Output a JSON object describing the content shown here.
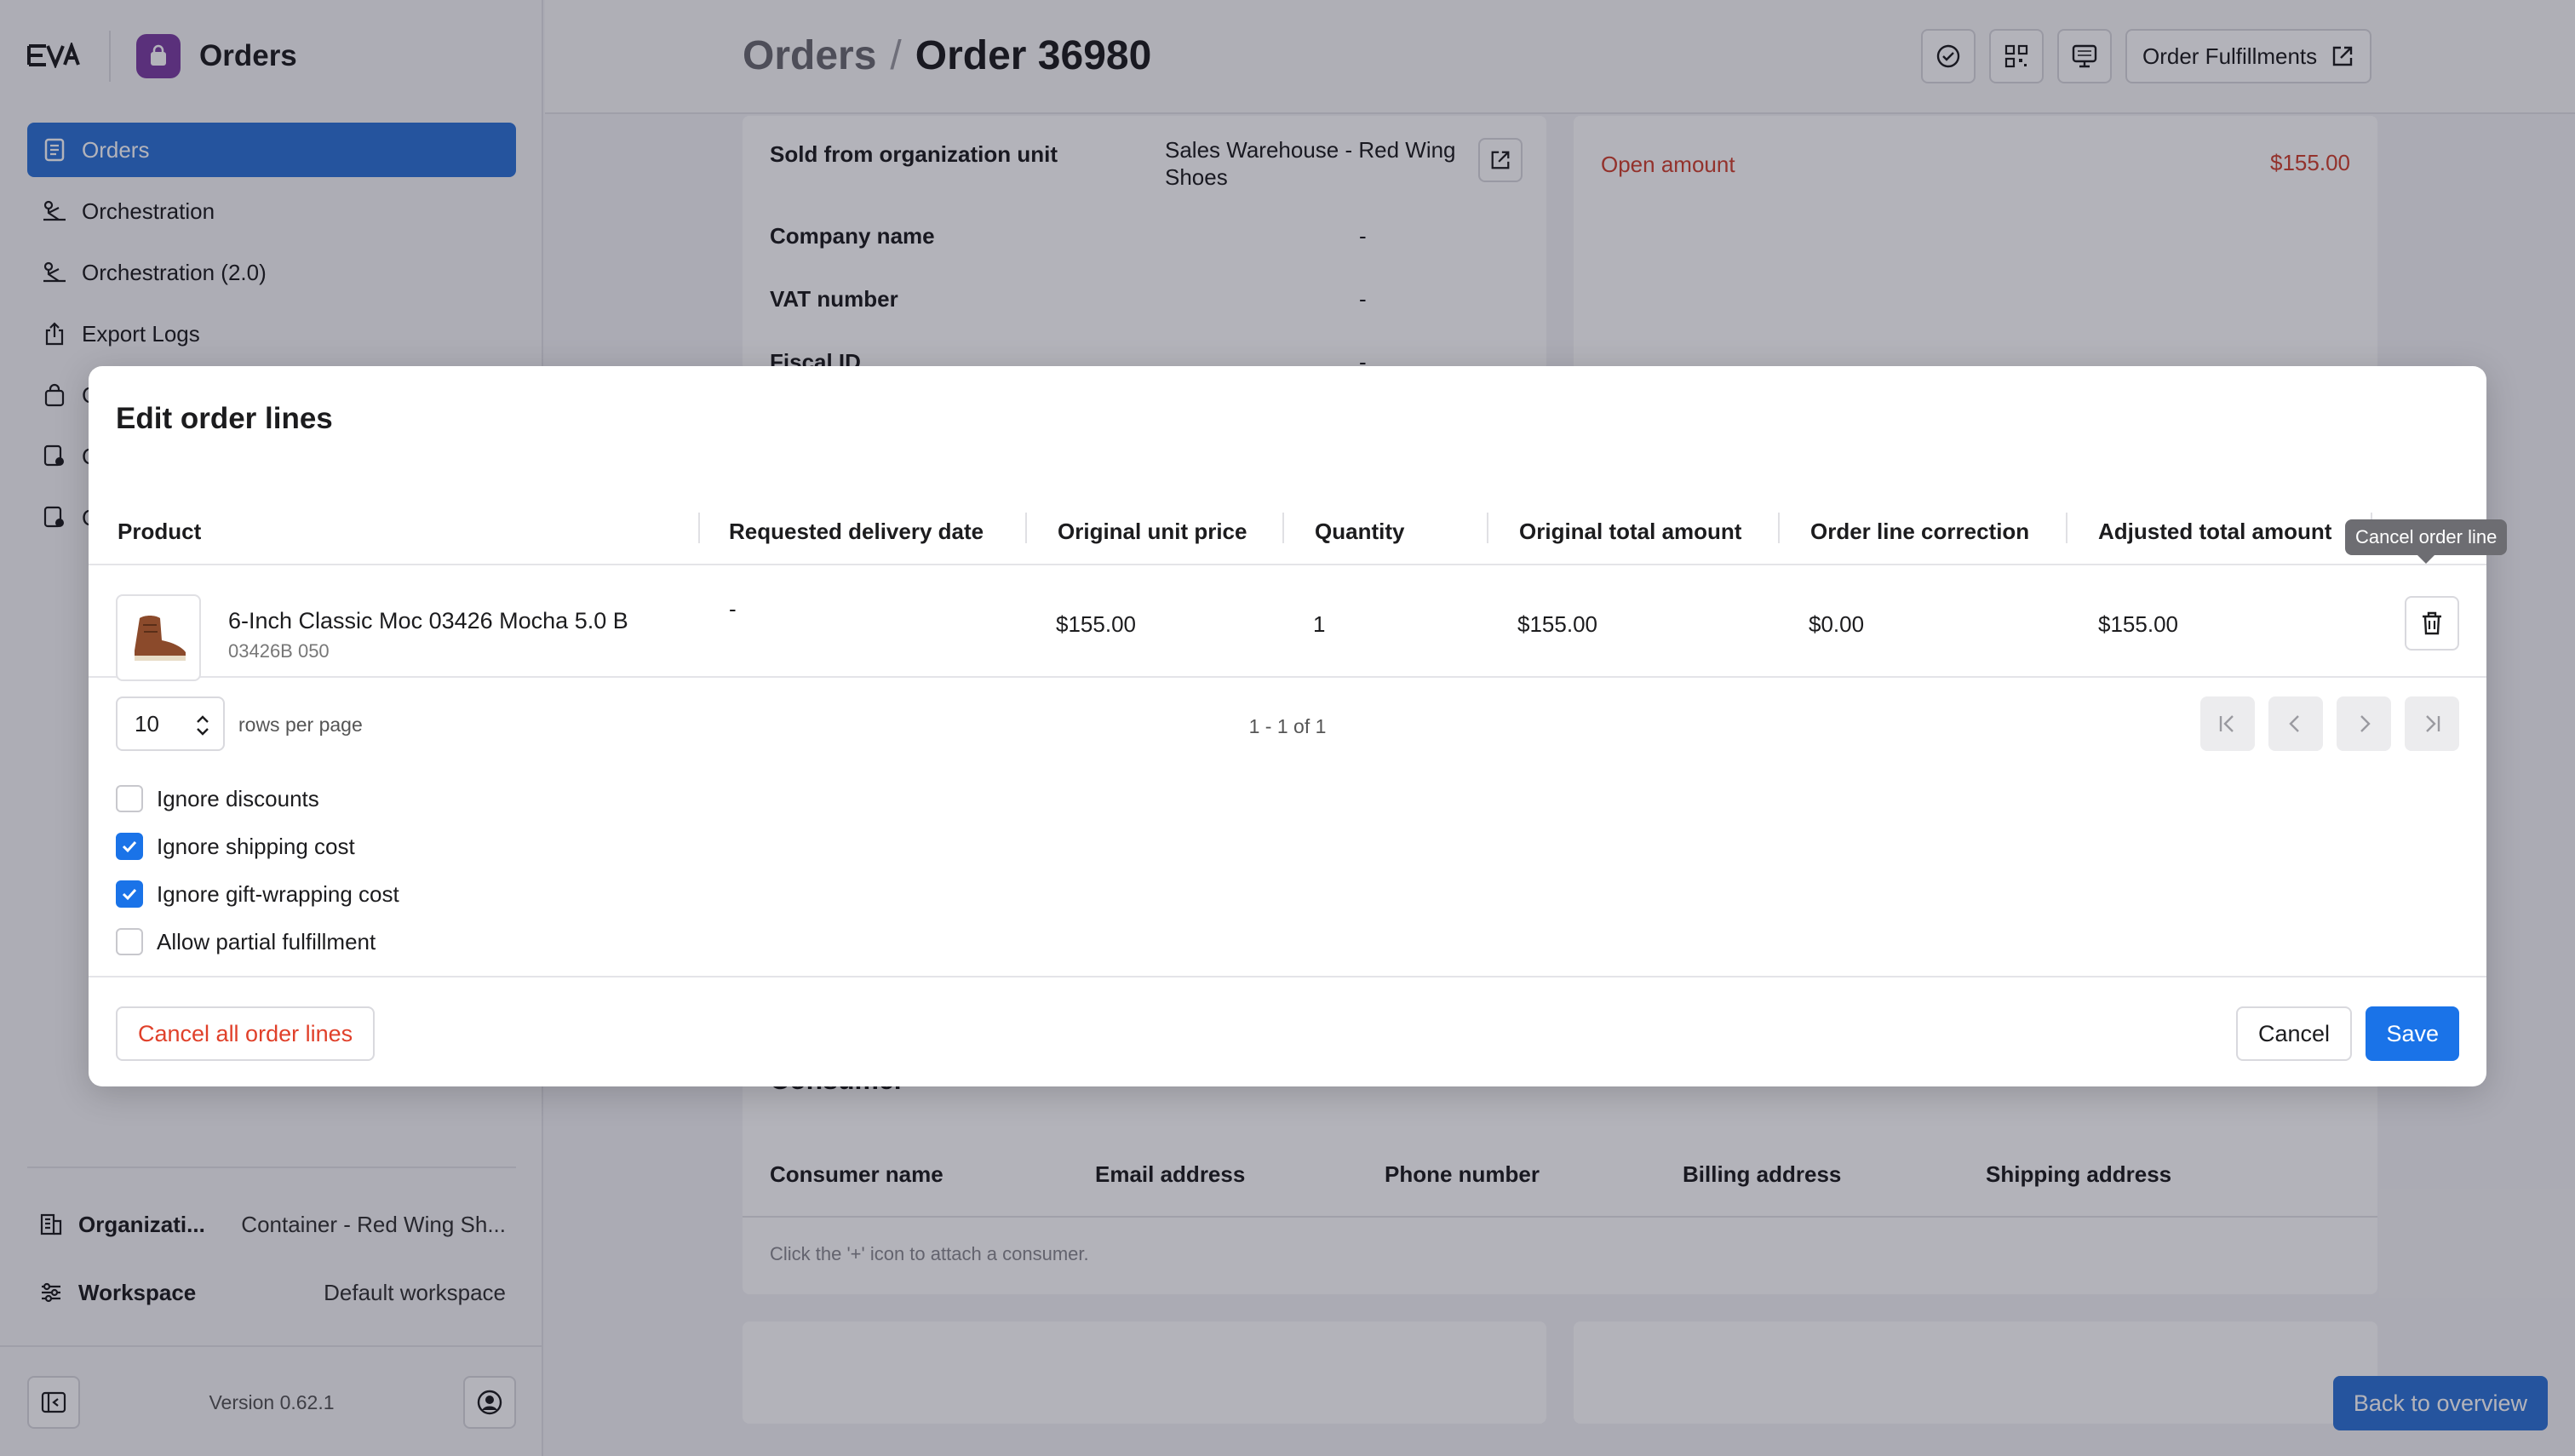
{
  "app": {
    "title": "Orders",
    "logo_text": "EVA"
  },
  "sidebar": {
    "items": [
      {
        "label": "Orders",
        "active": true
      },
      {
        "label": "Orchestration"
      },
      {
        "label": "Orchestration (2.0)"
      },
      {
        "label": "Export Logs"
      },
      {
        "label": "C"
      },
      {
        "label": "C"
      },
      {
        "label": "C"
      }
    ],
    "organization": {
      "label": "Organizati...",
      "value": "Container - Red Wing Sh..."
    },
    "workspace": {
      "label": "Workspace",
      "value": "Default workspace"
    },
    "version": "Version 0.62.1"
  },
  "header": {
    "breadcrumb_parent": "Orders",
    "separator": "/",
    "breadcrumb_current": "Order 36980",
    "fulfillments_label": "Order Fulfillments"
  },
  "details": {
    "sold_from_label": "Sold from organization unit",
    "sold_from_value": "Sales Warehouse - Red Wing Shoes",
    "company_label": "Company name",
    "company_value": "-",
    "vat_label": "VAT number",
    "vat_value": "-",
    "fiscal_label": "Fiscal ID",
    "fiscal_value": "-",
    "open_amount_label": "Open amount",
    "open_amount_value": "$155.00"
  },
  "consumer": {
    "title": "Consumer",
    "columns": [
      "Consumer name",
      "Email address",
      "Phone number",
      "Billing address",
      "Shipping address"
    ],
    "hint": "Click the '+' icon to attach a consumer."
  },
  "back_label": "Back to overview",
  "modal": {
    "title": "Edit order lines",
    "columns": [
      "Product",
      "Requested delivery date",
      "Original unit price",
      "Quantity",
      "Original total amount",
      "Order line correction",
      "Adjusted total amount"
    ],
    "rows": [
      {
        "product_name": "6-Inch Classic Moc 03426 Mocha 5.0 B",
        "sku": "03426B 050",
        "requested_delivery_date": "-",
        "original_unit_price": "$155.00",
        "quantity": "1",
        "original_total_amount": "$155.00",
        "order_line_correction": "$0.00",
        "adjusted_total_amount": "$155.00"
      }
    ],
    "tooltip": "Cancel order line",
    "rows_per_page_value": "10",
    "rows_per_page_label": "rows per page",
    "range": "1 - 1 of 1",
    "checkboxes": [
      {
        "label": "Ignore discounts",
        "checked": false
      },
      {
        "label": "Ignore shipping cost",
        "checked": true
      },
      {
        "label": "Ignore gift-wrapping cost",
        "checked": true
      },
      {
        "label": "Allow partial fulfillment",
        "checked": false
      }
    ],
    "cancel_all_label": "Cancel all order lines",
    "cancel_label": "Cancel",
    "save_label": "Save"
  },
  "colors": {
    "accent": "#1a73e8",
    "nav_active": "#2e74d6",
    "danger": "#e0402a",
    "app_icon": "#7d3ea3"
  }
}
